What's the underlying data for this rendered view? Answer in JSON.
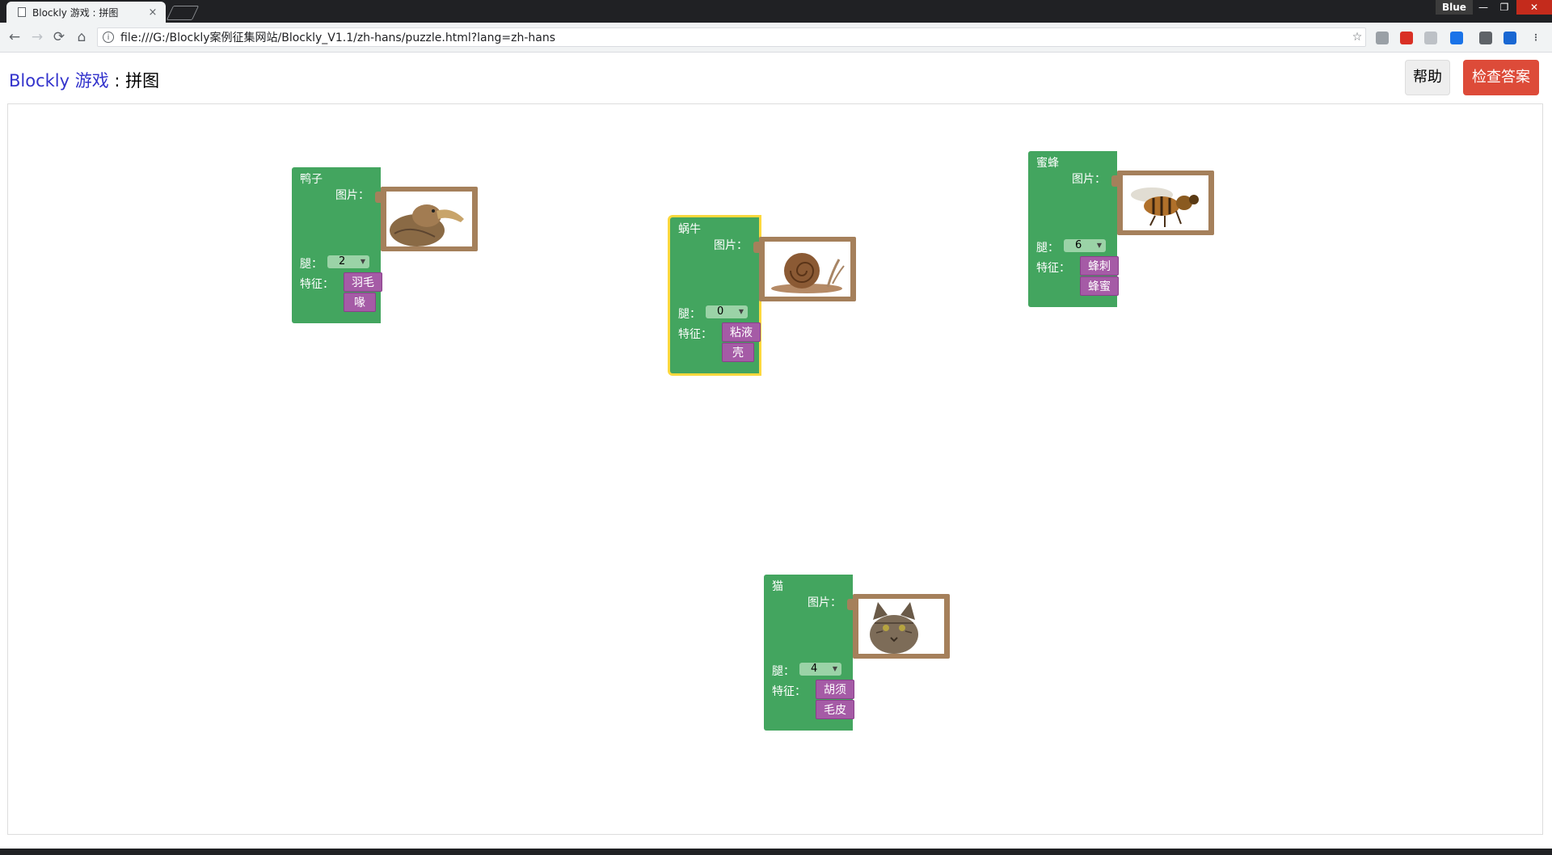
{
  "browser": {
    "tab_title": "Blockly 游戏 : 拼图",
    "tab_close": "×",
    "profile": "Blue",
    "url": "file:///G:/Blockly案例征集网站/Blockly_V1.1/zh-hans/puzzle.html?lang=zh-hans",
    "window_controls": [
      "—",
      "❐",
      "✕"
    ],
    "nav": {
      "back": "←",
      "forward": "→",
      "reload": "⟳",
      "home": "⌂"
    },
    "bookmark_star": "☆"
  },
  "header": {
    "title_link": "Blockly 游戏",
    "title_rest": " : 拼图",
    "help_button": "帮助",
    "check_button": "检查答案"
  },
  "labels": {
    "picture": "图片：",
    "legs": "腿：",
    "traits": "特征："
  },
  "blocks": {
    "duck": {
      "name": "鸭子",
      "legs": "2",
      "traits": [
        "羽毛",
        "喙"
      ]
    },
    "snail": {
      "name": "蜗牛",
      "legs": "0",
      "traits": [
        "粘液",
        "壳"
      ]
    },
    "bee": {
      "name": "蜜蜂",
      "legs": "6",
      "traits": [
        "蜂刺",
        "蜂蜜"
      ]
    },
    "cat": {
      "name": "猫",
      "legs": "4",
      "traits": [
        "胡须",
        "毛皮"
      ]
    }
  },
  "colors": {
    "animal_block": "#43a55f",
    "trait_block": "#a55ba6",
    "picture_block": "#a5805b",
    "selected_outline": "#fcd83d",
    "check_button": "#dd4b39"
  }
}
